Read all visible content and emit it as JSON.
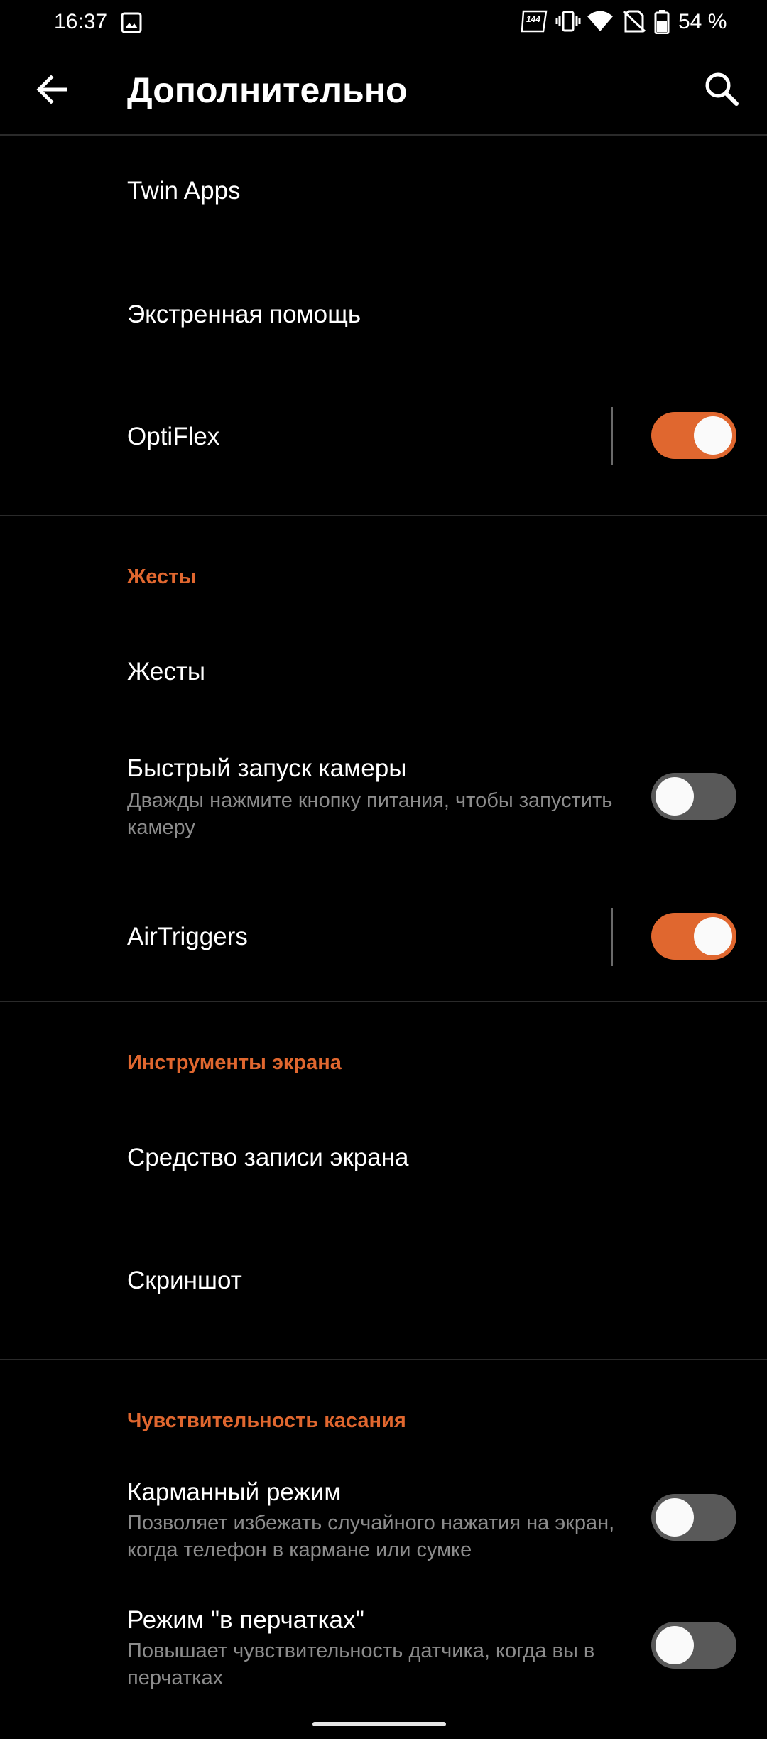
{
  "status_bar": {
    "time": "16:37",
    "refresh_rate": "144",
    "battery": "54 %"
  },
  "app_bar": {
    "title": "Дополнительно"
  },
  "items": {
    "twin_apps": {
      "title": "Twin Apps"
    },
    "emergency": {
      "title": "Экстренная помощь"
    },
    "optiflex": {
      "title": "OptiFlex",
      "enabled": true
    },
    "gestures_header": "Жесты",
    "gestures": {
      "title": "Жесты"
    },
    "quick_camera": {
      "title": "Быстрый запуск камеры",
      "summary": "Дважды нажмите кнопку питания, чтобы запустить камеру",
      "enabled": false
    },
    "airtriggers": {
      "title": "AirTriggers",
      "enabled": true
    },
    "screen_tools_header": "Инструменты экрана",
    "screen_recorder": {
      "title": "Средство записи экрана"
    },
    "screenshot": {
      "title": "Скриншот"
    },
    "touch_header": "Чувствительность касания",
    "pocket_mode": {
      "title": "Карманный режим",
      "summary": "Позволяет избежать случайного нажатия на экран, когда телефон в кармане или сумке",
      "enabled": false
    },
    "glove_mode": {
      "title": "Режим \"в перчатках\"",
      "summary": "Повышает чувствительность датчика, когда вы в перчатках",
      "enabled": false
    }
  },
  "colors": {
    "accent": "#e0672f",
    "background": "#000000",
    "toggle_off": "#595959",
    "secondary_text": "#8c8c8c"
  }
}
